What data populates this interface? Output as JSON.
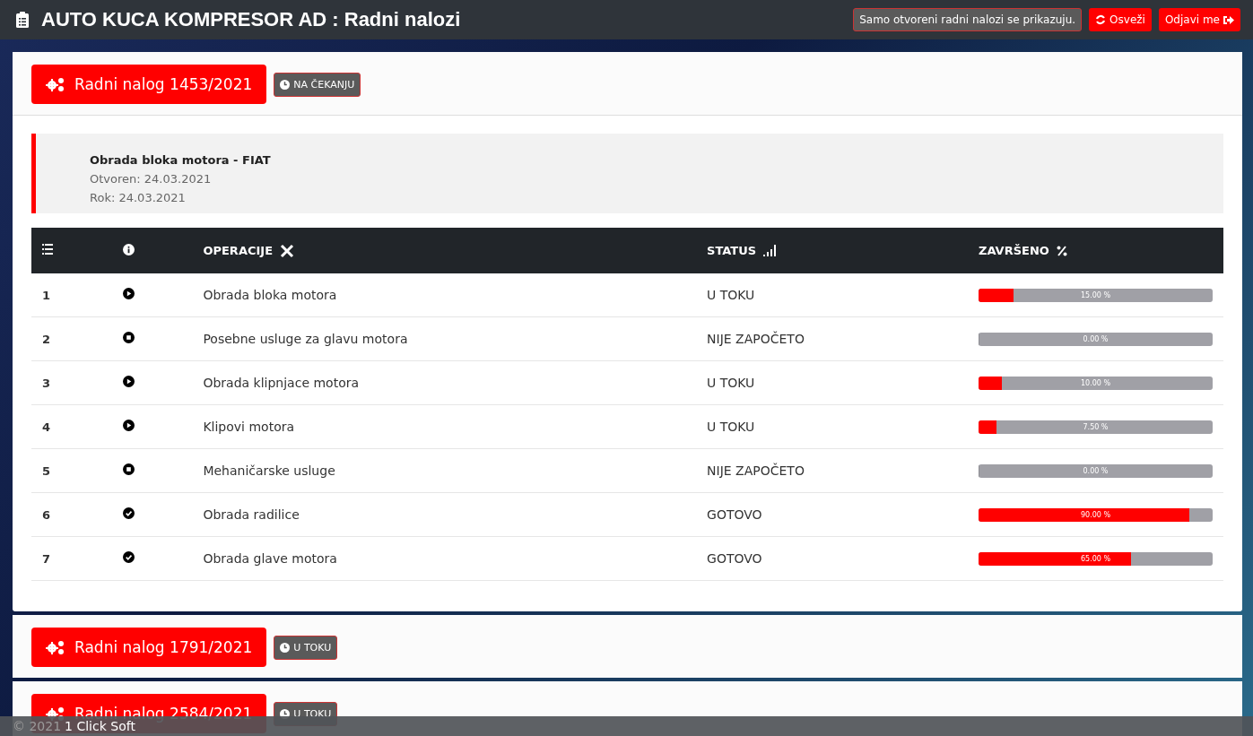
{
  "header": {
    "title": "AUTO KUCA KOMPRESOR AD : Radni nalozi",
    "notice": "Samo otvoreni radni nalozi se prikazuju.",
    "refresh_button": "Osveži",
    "logout_button": "Odjavi me"
  },
  "orders": [
    {
      "title": "Radni nalog 1453/2021",
      "badge": "NA ČEKANJU",
      "expanded": true,
      "info": {
        "name": "Obrada bloka motora - FIAT",
        "opened": "Otvoren: 24.03.2021",
        "deadline": "Rok: 24.03.2021"
      },
      "table": {
        "columns": [
          "OPERACIJE",
          "STATUS",
          "ZAVRŠENO"
        ],
        "rows": [
          {
            "number": "1",
            "kind": "play",
            "operation": "Obrada bloka motora",
            "status": "U TOKU",
            "level": 0.15,
            "progress": "15.00 %"
          },
          {
            "number": "2",
            "kind": "stop",
            "operation": "Posebne usluge za glavu motora",
            "status": "NIJE ZAPOČETO",
            "level": 0,
            "progress": "0.00 %"
          },
          {
            "number": "3",
            "kind": "play",
            "operation": "Obrada klipnjace motora",
            "status": "U TOKU",
            "level": 0.1,
            "progress": "10.00 %"
          },
          {
            "number": "4",
            "kind": "play",
            "operation": "Klipovi motora",
            "status": "U TOKU",
            "level": 0.075,
            "progress": "7.50 %"
          },
          {
            "number": "5",
            "kind": "stop",
            "operation": "Mehaničarske usluge",
            "status": "NIJE ZAPOČETO",
            "level": 0,
            "progress": "0.00 %"
          },
          {
            "number": "6",
            "kind": "done",
            "operation": "Obrada radilice",
            "status": "GOTOVO",
            "level": 0.9,
            "progress": "90.00 %"
          },
          {
            "number": "7",
            "kind": "done",
            "operation": "Obrada glave motora",
            "status": "GOTOVO",
            "level": 0.65,
            "progress": "65.00 %"
          }
        ]
      }
    },
    {
      "title": "Radni nalog 1791/2021",
      "badge": "U TOKU",
      "expanded": false
    },
    {
      "title": "Radni nalog 2584/2021",
      "badge": "U TOKU",
      "expanded": false
    }
  ],
  "footer": {
    "copyright": "© 2021",
    "company": "1 Click Soft"
  }
}
